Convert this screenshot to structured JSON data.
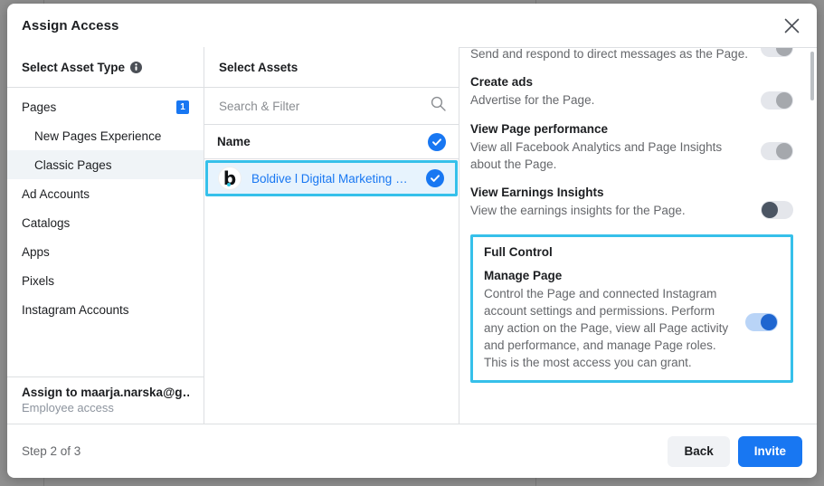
{
  "modal": {
    "title": "Assign Access",
    "close_icon": "close-icon"
  },
  "asset_type_panel": {
    "heading": "Select Asset Type",
    "info_icon": "info-icon",
    "items": [
      {
        "label": "Pages",
        "sub": false,
        "selected": false,
        "badge": "1"
      },
      {
        "label": "New Pages Experience",
        "sub": true,
        "selected": false,
        "badge": ""
      },
      {
        "label": "Classic Pages",
        "sub": true,
        "selected": true,
        "badge": ""
      },
      {
        "label": "Ad Accounts",
        "sub": false,
        "selected": false,
        "badge": ""
      },
      {
        "label": "Catalogs",
        "sub": false,
        "selected": false,
        "badge": ""
      },
      {
        "label": "Apps",
        "sub": false,
        "selected": false,
        "badge": ""
      },
      {
        "label": "Pixels",
        "sub": false,
        "selected": false,
        "badge": ""
      },
      {
        "label": "Instagram Accounts",
        "sub": false,
        "selected": false,
        "badge": ""
      }
    ],
    "assign_to_name": "Assign to maarja.narska@g…",
    "assign_to_role": "Employee access"
  },
  "assets_panel": {
    "heading": "Select Assets",
    "search_placeholder": "Search & Filter",
    "search_value": "",
    "search_icon": "search-icon",
    "column_header": "Name",
    "header_checked": true,
    "rows": [
      {
        "name": "Boldive l Digital Marketing …",
        "logo_letter": "b",
        "checked": true,
        "highlighted": true
      }
    ]
  },
  "permissions_panel": {
    "items": [
      {
        "title": "",
        "desc": "Send and respond to direct messages as the Page.",
        "toggle": "off",
        "clipped_top": true
      },
      {
        "title": "Create ads",
        "desc": "Advertise for the Page.",
        "toggle": "off",
        "clipped_top": false
      },
      {
        "title": "View Page performance",
        "desc": "View all Facebook Analytics and Page Insights about the Page.",
        "toggle": "off",
        "clipped_top": false
      },
      {
        "title": "View Earnings Insights",
        "desc": "View the earnings insights for the Page.",
        "toggle": "off-dark",
        "clipped_top": false
      }
    ],
    "full_control": {
      "section_label": "Full Control",
      "title": "Manage Page",
      "desc": "Control the Page and connected Instagram account settings and permissions. Perform any action on the Page, view all Page activity and performance, and manage Page roles. This is the most access you can grant.",
      "toggle": "on",
      "highlighted": true
    }
  },
  "footer": {
    "step_label": "Step 2 of 3",
    "back_label": "Back",
    "invite_label": "Invite"
  },
  "colors": {
    "accent_blue": "#1877f2",
    "highlight_cyan": "#36c0ea",
    "row_highlight_bg": "#e7f3fd",
    "selected_item_bg": "#f0f4f7",
    "text_primary": "#1c1e21",
    "text_secondary": "#65676b"
  }
}
